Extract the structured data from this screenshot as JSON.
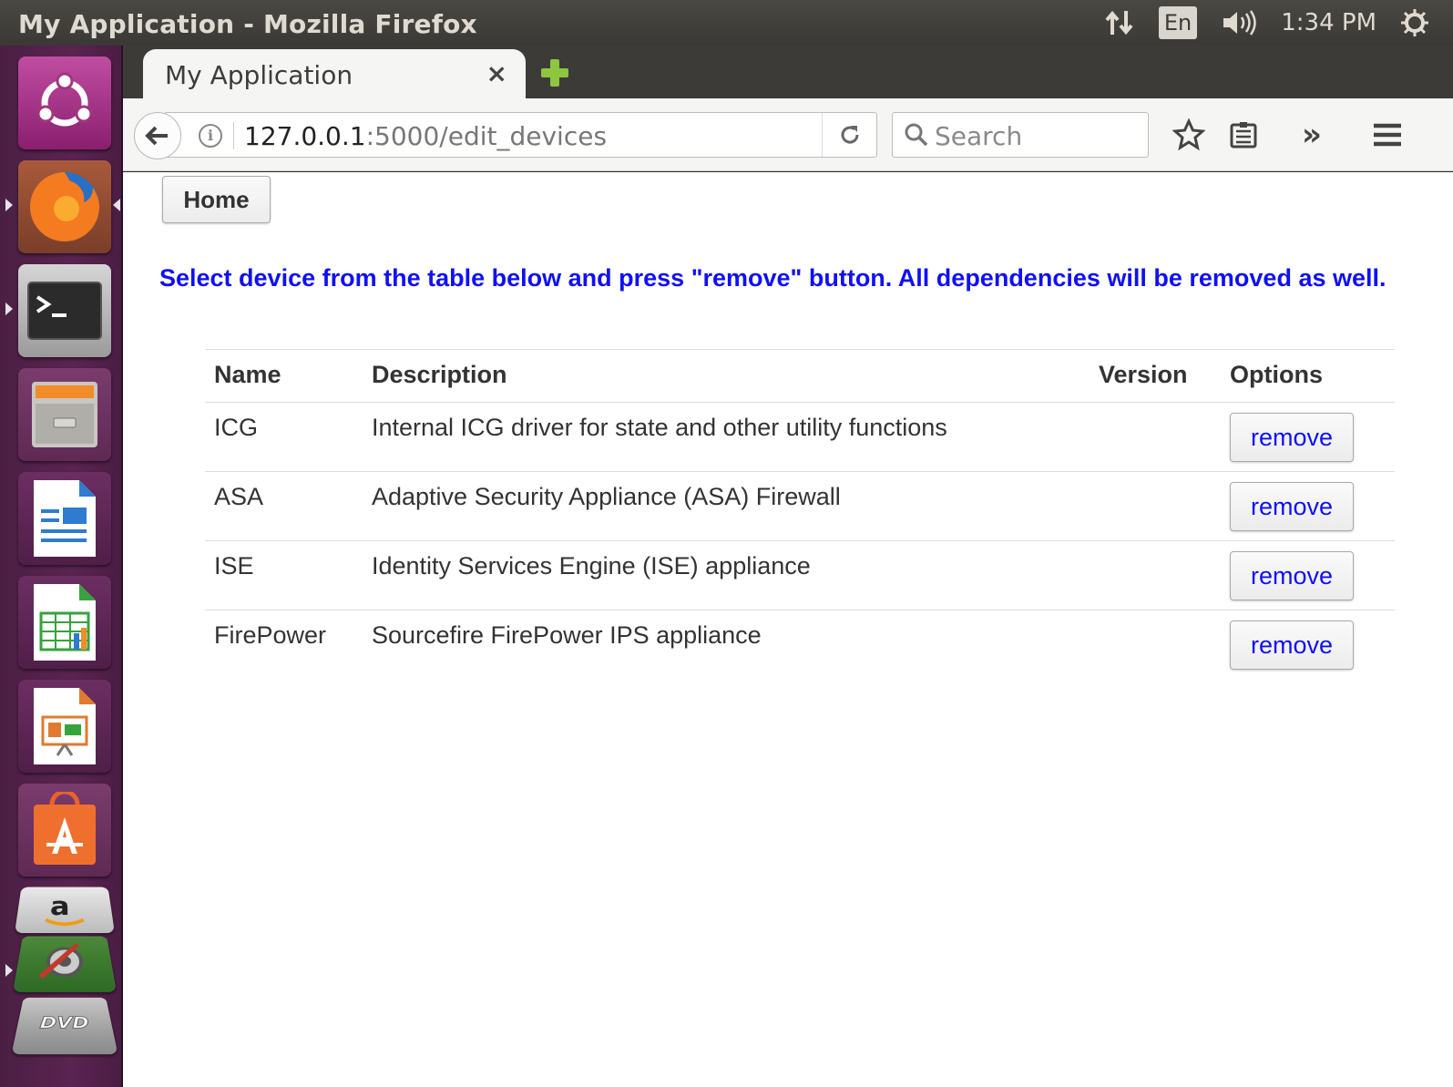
{
  "window": {
    "title": "My Application - Mozilla Firefox"
  },
  "tray": {
    "keyboard_layout": "En",
    "clock": "1:34 PM"
  },
  "launcher": {
    "items": [
      {
        "name": "ubuntu-dash-icon"
      },
      {
        "name": "firefox-icon"
      },
      {
        "name": "terminal-icon"
      },
      {
        "name": "files-icon"
      },
      {
        "name": "writer-icon"
      },
      {
        "name": "calc-icon"
      },
      {
        "name": "impress-icon"
      },
      {
        "name": "software-center-icon"
      },
      {
        "name": "amazon-icon"
      },
      {
        "name": "system-settings-icon"
      },
      {
        "name": "dvd-icon"
      }
    ]
  },
  "browser": {
    "tab_title": "My Application",
    "tab_close": "×",
    "url_host": "127.0.0.1",
    "url_rest": ":5000/edit_devices",
    "search_placeholder": "Search",
    "overflow": "»"
  },
  "page": {
    "home_label": "Home",
    "instructions": "Select device from the table below and press \"remove\" button. All dependencies will be removed as well.",
    "table": {
      "headers": {
        "name": "Name",
        "description": "Description",
        "version": "Version",
        "options": "Options"
      },
      "rows": [
        {
          "name": "ICG",
          "description": "Internal ICG driver for state and other utility functions",
          "version": "",
          "action": "remove"
        },
        {
          "name": "ASA",
          "description": "Adaptive Security Appliance (ASA) Firewall",
          "version": "",
          "action": "remove"
        },
        {
          "name": "ISE",
          "description": "Identity Services Engine (ISE) appliance",
          "version": "",
          "action": "remove"
        },
        {
          "name": "FirePower",
          "description": "Sourcefire FirePower IPS appliance",
          "version": "",
          "action": "remove"
        }
      ]
    }
  },
  "colors": {
    "instruction_text": "#1010f5",
    "launcher_bg": "#5a2450",
    "topbar_bg": "#3c3b37"
  }
}
